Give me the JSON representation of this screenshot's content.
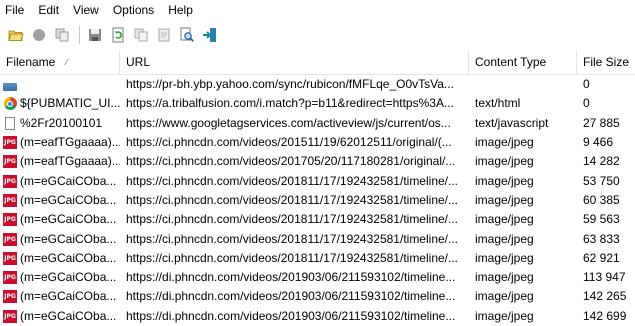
{
  "menu": [
    "File",
    "Edit",
    "View",
    "Options",
    "Help"
  ],
  "toolbar": {
    "buttons": [
      "open-folder-icon",
      "stop-icon",
      "copy-files-icon",
      "save-icon",
      "refresh-icon",
      "copy-icon",
      "properties-icon",
      "search-icon",
      "exit-icon"
    ]
  },
  "table": {
    "columns": [
      "Filename",
      "URL",
      "Content Type",
      "File Size"
    ],
    "rows": [
      {
        "icon": "blank",
        "filename": "",
        "url": "https://pr-bh.ybp.yahoo.com/sync/rubicon/fMFLqe_O0vTsVa...",
        "type": "",
        "size": "0"
      },
      {
        "icon": "chrome",
        "filename": "${PUBMATIC_UI...",
        "url": "https://a.tribalfusion.com/i.match?p=b11&redirect=https%3A...",
        "type": "text/html",
        "size": "0"
      },
      {
        "icon": "doc",
        "filename": "%2Fr20100101",
        "url": "https://www.googletagservices.com/activeview/js/current/os...",
        "type": "text/javascript",
        "size": "27 885"
      },
      {
        "icon": "jpg",
        "filename": "(m=eafTGgaaaa)...",
        "url": "https://ci.phncdn.com/videos/201511/19/62012511/original/(...",
        "type": "image/jpeg",
        "size": "9 466"
      },
      {
        "icon": "jpg",
        "filename": "(m=eafTGgaaaa)...",
        "url": "https://ci.phncdn.com/videos/201705/20/117180281/original/...",
        "type": "image/jpeg",
        "size": "14 282"
      },
      {
        "icon": "jpg",
        "filename": "(m=eGCaiCOba...",
        "url": "https://ci.phncdn.com/videos/201811/17/192432581/timeline/...",
        "type": "image/jpeg",
        "size": "53 750"
      },
      {
        "icon": "jpg",
        "filename": "(m=eGCaiCOba...",
        "url": "https://ci.phncdn.com/videos/201811/17/192432581/timeline/...",
        "type": "image/jpeg",
        "size": "60 385"
      },
      {
        "icon": "jpg",
        "filename": "(m=eGCaiCOba...",
        "url": "https://ci.phncdn.com/videos/201811/17/192432581/timeline/...",
        "type": "image/jpeg",
        "size": "59 563"
      },
      {
        "icon": "jpg",
        "filename": "(m=eGCaiCOba...",
        "url": "https://ci.phncdn.com/videos/201811/17/192432581/timeline/...",
        "type": "image/jpeg",
        "size": "63 833"
      },
      {
        "icon": "jpg",
        "filename": "(m=eGCaiCOba...",
        "url": "https://ci.phncdn.com/videos/201811/17/192432581/timeline/...",
        "type": "image/jpeg",
        "size": "62 921"
      },
      {
        "icon": "jpg",
        "filename": "(m=eGCaiCOba...",
        "url": "https://di.phncdn.com/videos/201903/06/211593102/timeline...",
        "type": "image/jpeg",
        "size": "113 947"
      },
      {
        "icon": "jpg",
        "filename": "(m=eGCaiCOba...",
        "url": "https://di.phncdn.com/videos/201903/06/211593102/timeline...",
        "type": "image/jpeg",
        "size": "142 265"
      },
      {
        "icon": "jpg",
        "filename": "(m=eGCaiCOba...",
        "url": "https://di.phncdn.com/videos/201903/06/211593102/timeline...",
        "type": "image/jpeg",
        "size": "142 699"
      }
    ]
  }
}
